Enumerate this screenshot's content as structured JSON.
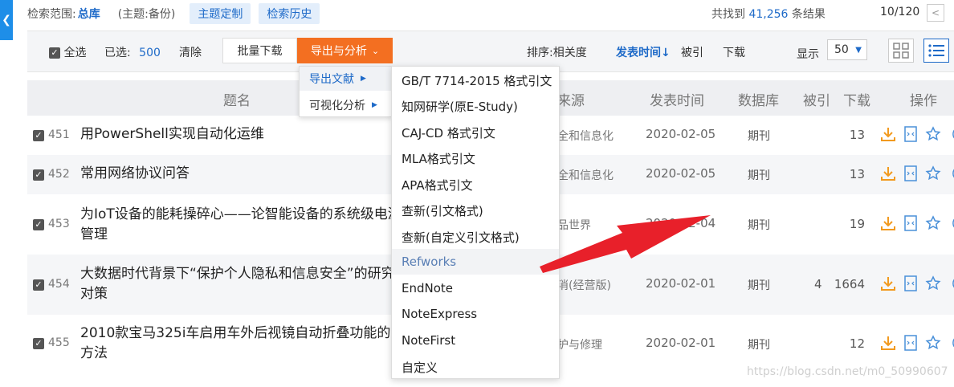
{
  "search_bar": {
    "scope_label": "检索范围:",
    "scope_value": "总库",
    "topic": "(主题:备份)",
    "topic_custom_button": "主题定制",
    "history_button": "检索历史",
    "found_prefix": "共找到",
    "found_count": "41,256",
    "found_suffix": "条结果",
    "page_indicator": "10/120",
    "prev_page_icon": "chevron-left-icon"
  },
  "toolbar": {
    "select_all_label": "全选",
    "selected_label": "已选:",
    "selected_count": "500",
    "clear_label": "清除",
    "batch_download_label": "批量下载",
    "export_analysis_label": "导出与分析",
    "sort_label": "排序:",
    "sort_relevance": "相关度",
    "sort_pubdate": "发表时间",
    "sort_cited": "被引",
    "sort_download": "下载",
    "display_label": "显示",
    "display_value": "50",
    "accent_color": "#f36f21",
    "link_color": "#1e6ac8"
  },
  "export_menu": {
    "items": [
      {
        "label": "导出文献"
      },
      {
        "label": "可视化分析"
      }
    ],
    "formats": [
      "GB/T 7714-2015 格式引文",
      "知网研学(原E-Study)",
      "CAJ-CD 格式引文",
      "MLA格式引文",
      "APA格式引文",
      "查新(引文格式)",
      "查新(自定义引文格式)",
      "Refworks",
      "EndNote",
      "NoteExpress",
      "NoteFirst",
      "自定义"
    ]
  },
  "table": {
    "headers": {
      "title": "题名",
      "source": "来源",
      "date": "发表时间",
      "database": "数据库",
      "cited": "被引",
      "downloads": "下载",
      "ops": "操作"
    },
    "rows": [
      {
        "num": "451",
        "title": "用PowerShell实现自动化运维",
        "source": "全和信息化",
        "date": "2020-02-05",
        "db": "期刊",
        "cite": "",
        "dl": "13"
      },
      {
        "num": "452",
        "title": "常用网络协议问答",
        "source": "全和信息化",
        "date": "2020-02-05",
        "db": "期刊",
        "cite": "",
        "dl": "13"
      },
      {
        "num": "453",
        "title": "为IoT设备的能耗操碎心——论智能设备的系统级电源管理",
        "source": "品世界",
        "date": "2020-02-04",
        "db": "期刊",
        "cite": "",
        "dl": "19"
      },
      {
        "num": "454",
        "title": "大数据时代背景下“保护个人隐私和信息安全”的研究对策",
        "source": "消(经营版)",
        "date": "2020-02-01",
        "db": "期刊",
        "cite": "4",
        "dl": "1664"
      },
      {
        "num": "455",
        "title": "2010款宝马325i车启用车外后视镜自动折叠功能的方法",
        "source": "护与修理",
        "date": "2020-02-01",
        "db": "期刊",
        "cite": "",
        "dl": "12"
      }
    ]
  },
  "watermark": "https://blog.csdn.net/m0_50990607"
}
